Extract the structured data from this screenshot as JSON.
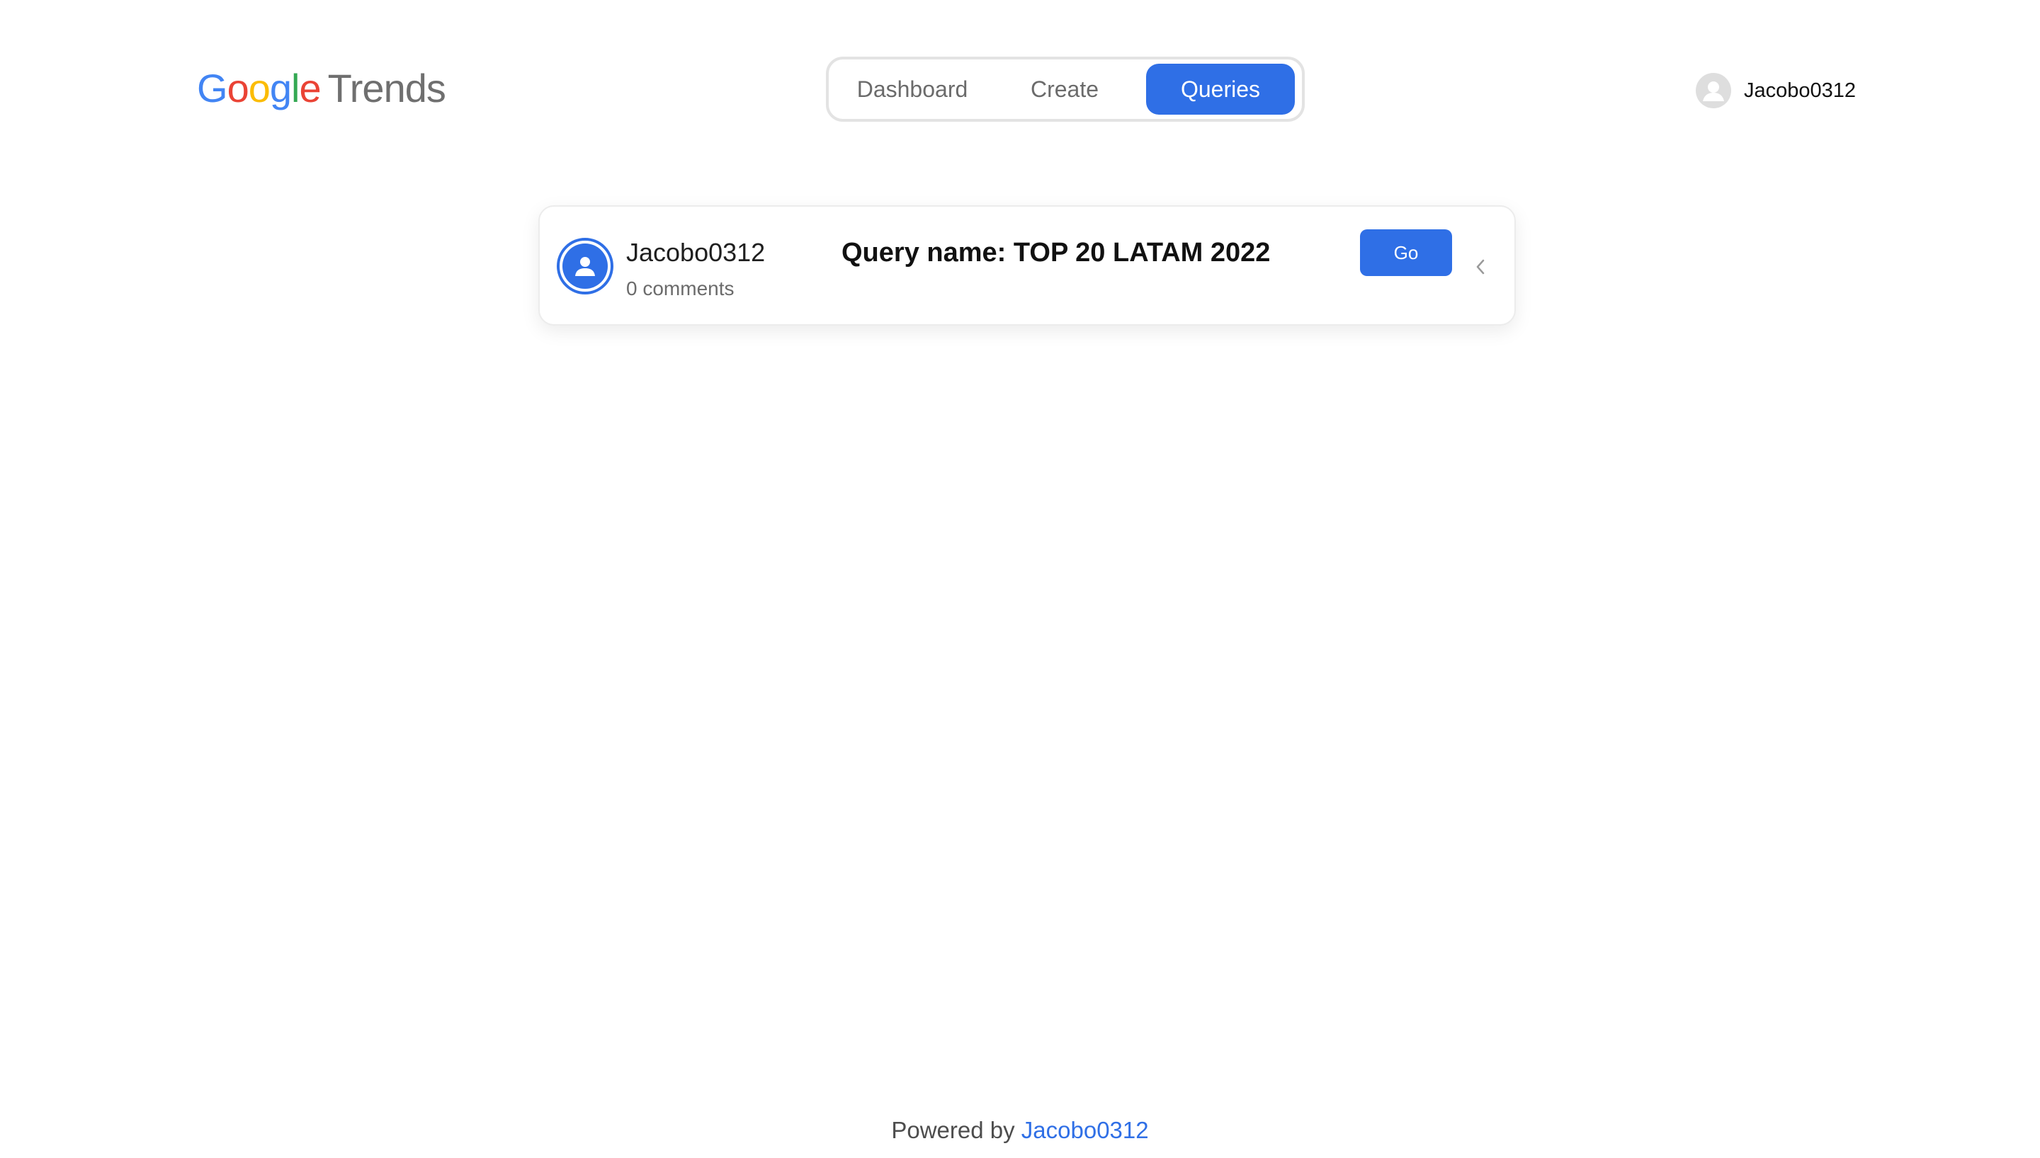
{
  "header": {
    "logo": {
      "google_letters": [
        {
          "char": "G",
          "color": "#4285F4"
        },
        {
          "char": "o",
          "color": "#EA4335"
        },
        {
          "char": "o",
          "color": "#FBBC05"
        },
        {
          "char": "g",
          "color": "#4285F4"
        },
        {
          "char": "l",
          "color": "#34A853"
        },
        {
          "char": "e",
          "color": "#EA4335"
        }
      ],
      "suffix": "Trends"
    },
    "nav": {
      "tabs": [
        {
          "label": "Dashboard",
          "active": false
        },
        {
          "label": "Create",
          "active": false
        },
        {
          "label": "Queries",
          "active": true
        }
      ]
    },
    "user": {
      "name": "Jacobo0312",
      "icon": "user-avatar-icon"
    }
  },
  "query_card": {
    "author": "Jacobo0312",
    "comments": "0 comments",
    "query_title": "Query name: TOP 20 LATAM 2022",
    "go_label": "Go",
    "expand_icon": "chevron-left-icon",
    "avatar_icon": "user-icon"
  },
  "footer": {
    "prefix": "Powered by",
    "link_text": "Jacobo0312"
  },
  "colors": {
    "accent": "#2f6fe6",
    "text": "#111111",
    "muted": "#6b6b6b"
  }
}
